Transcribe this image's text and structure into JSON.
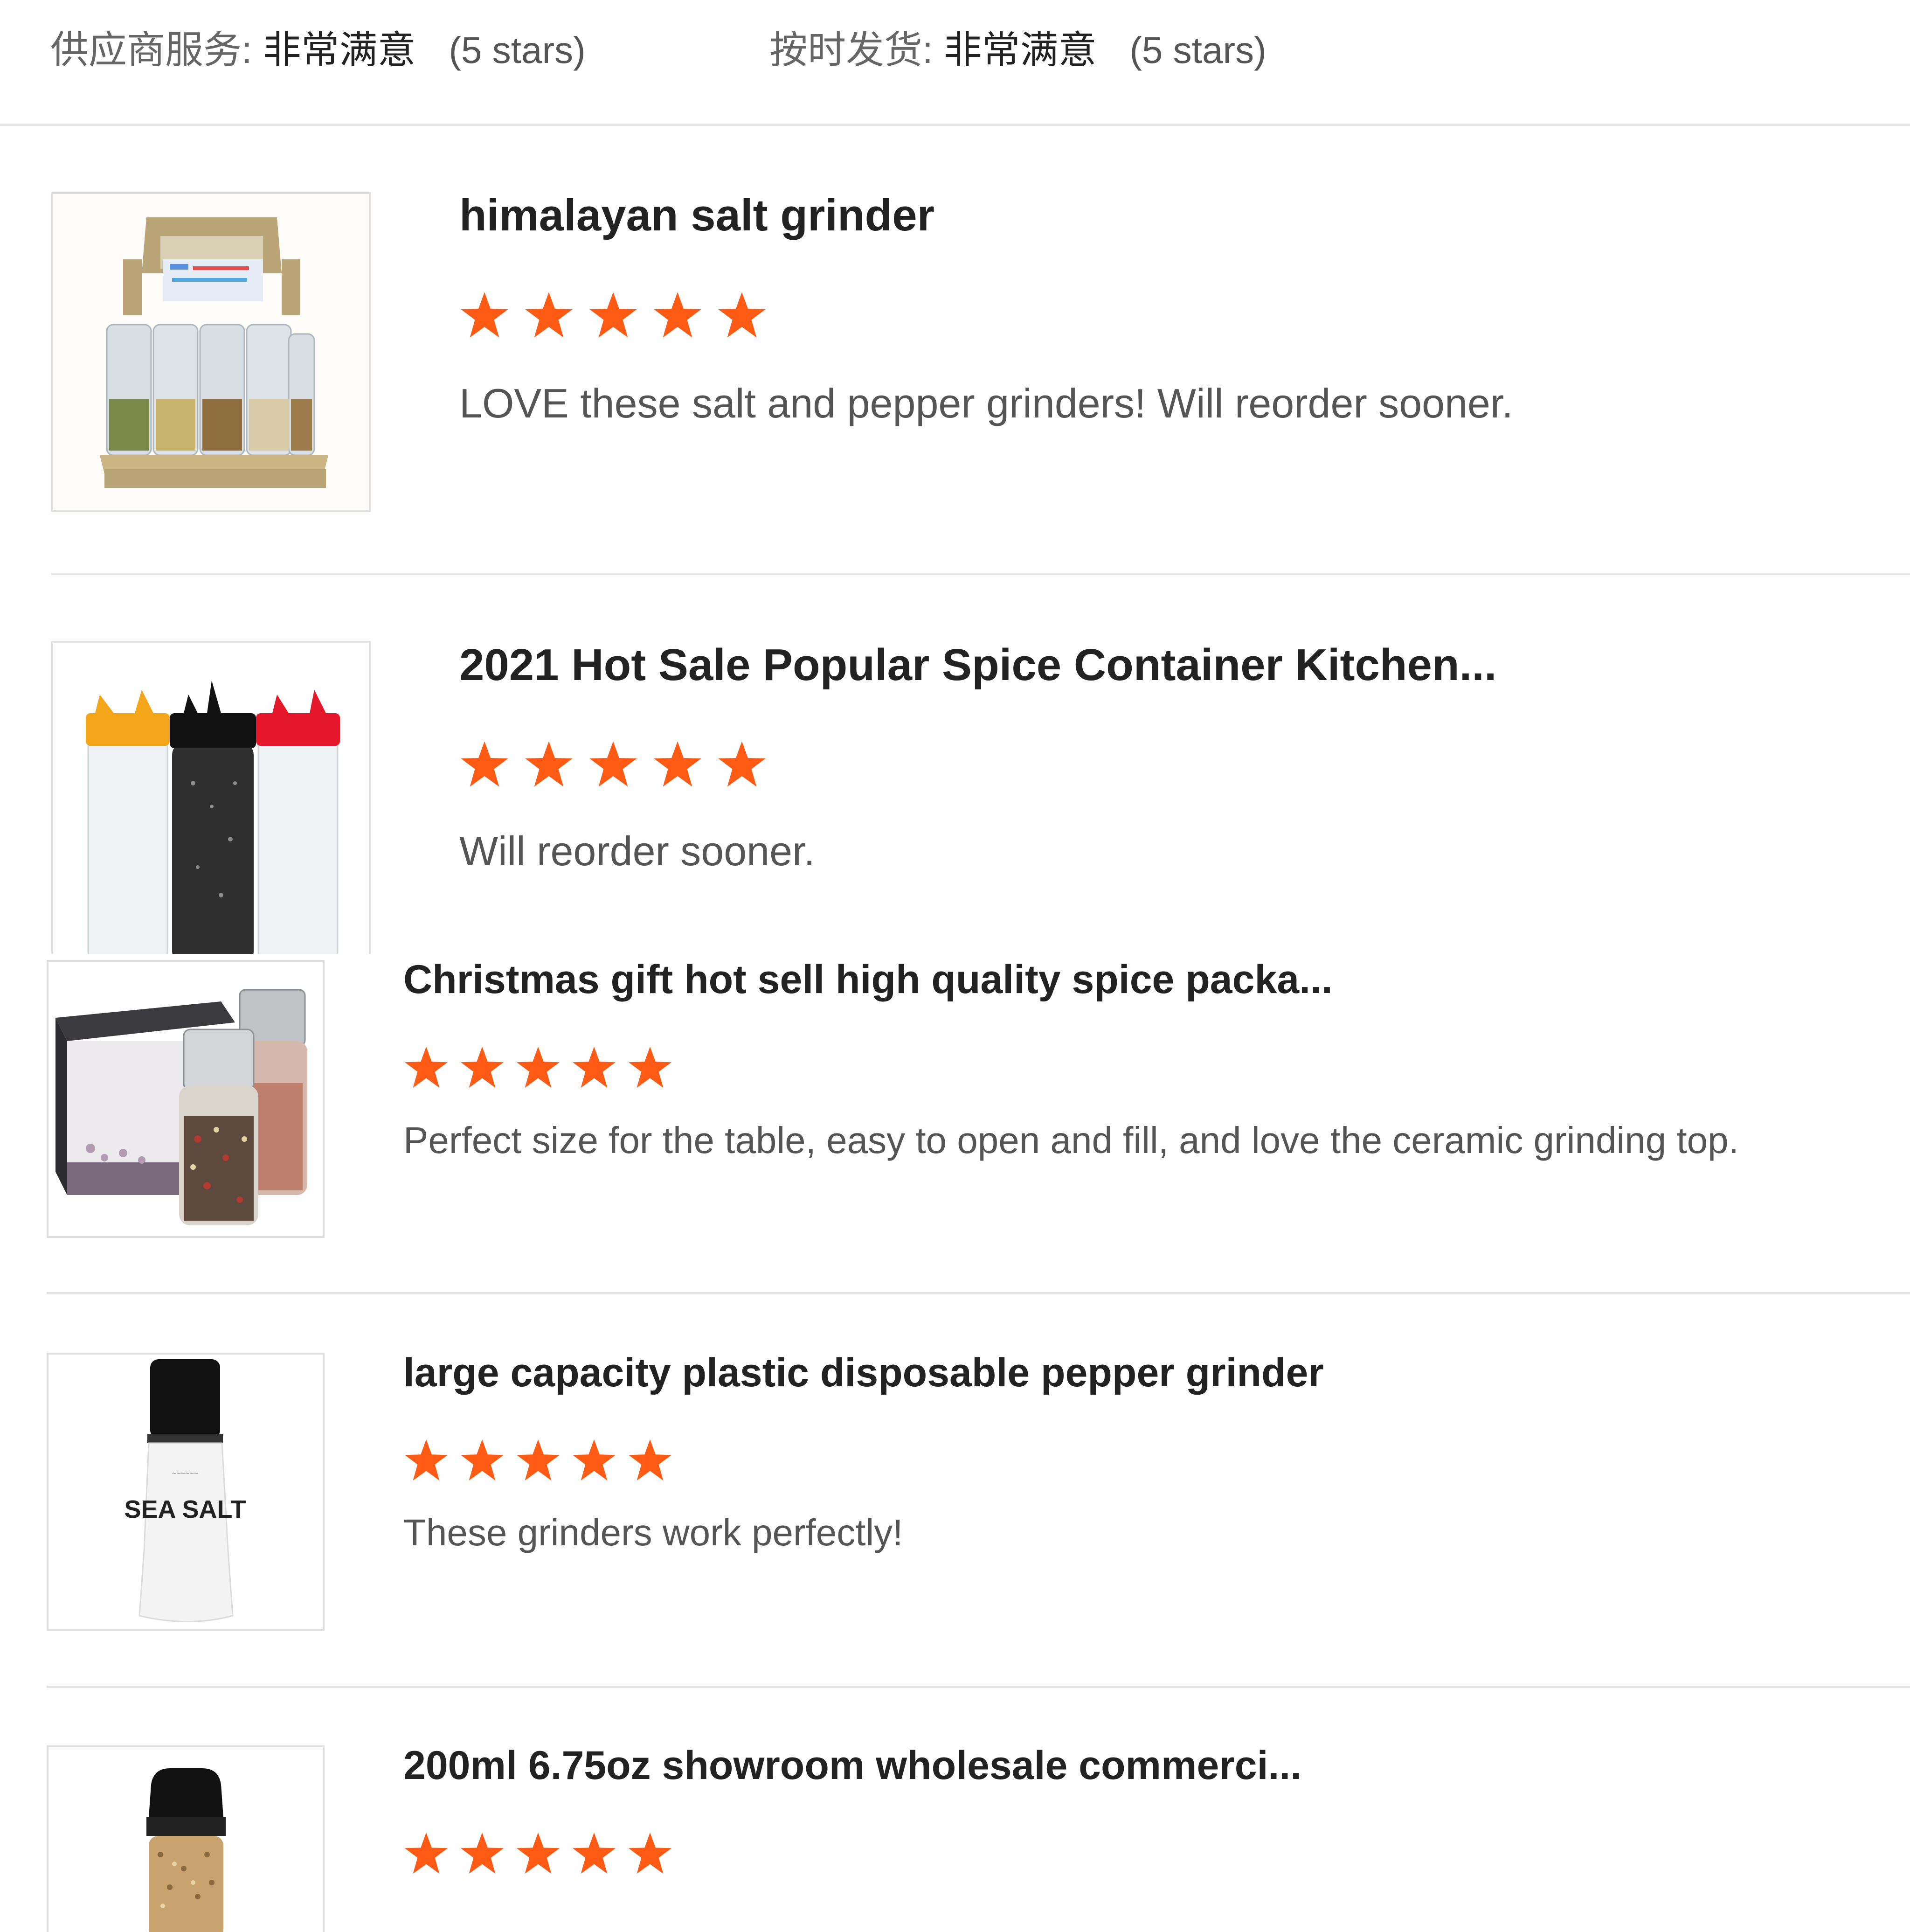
{
  "ratings": [
    {
      "label": "供应商服务:",
      "value": "非常满意",
      "stars": "(5 stars)"
    },
    {
      "label": "按时发货:",
      "value": "非常满意",
      "stars": "(5 stars)"
    }
  ],
  "star_color": "#ff5b14",
  "reviews": [
    {
      "title": "himalayan salt grinder",
      "rating": 5,
      "comment": "LOVE these salt and pepper grinders! Will reorder sooner."
    },
    {
      "title": "2021 Hot Sale Popular Spice Container Kitchen...",
      "rating": 5,
      "comment": "Will reorder sooner."
    },
    {
      "title": "Christmas gift hot sell high quality spice packa...",
      "rating": 5,
      "comment": "Perfect size for the table, easy to open and fill, and love the ceramic grinding top."
    },
    {
      "title": "large capacity plastic disposable pepper grinder",
      "rating": 5,
      "comment": "These grinders work perfectly!"
    },
    {
      "title": "200ml 6.75oz showroom wholesale commerci...",
      "rating": 5,
      "comment": ""
    }
  ],
  "thumbnail_text": {
    "sea_salt": "SEA SALT"
  }
}
